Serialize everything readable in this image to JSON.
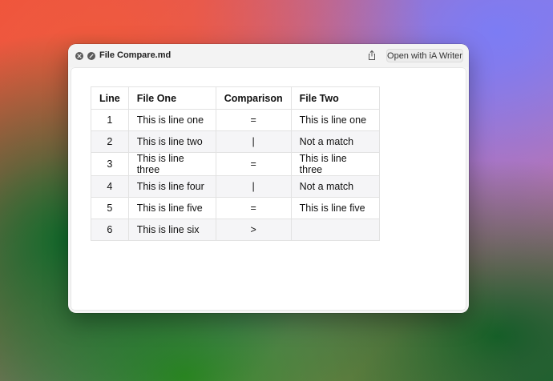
{
  "window": {
    "title": "File Compare.md",
    "open_button_label": "Open with iA Writer"
  },
  "table": {
    "headers": [
      "Line",
      "File One",
      "Comparison",
      "File Two"
    ],
    "rows": [
      [
        "1",
        "This is line one",
        "=",
        "This is line one"
      ],
      [
        "2",
        "This is line two",
        "|",
        "Not a match"
      ],
      [
        "3",
        "This is line three",
        "=",
        "This is line three"
      ],
      [
        "4",
        "This is line four",
        "|",
        "Not a match"
      ],
      [
        "5",
        "This is line five",
        "=",
        "This is line five"
      ],
      [
        "6",
        "This is line six",
        ">",
        ""
      ]
    ]
  },
  "icons": {
    "close": "close-icon",
    "minimize": "minimize-icon",
    "share": "share-icon"
  },
  "colors": {
    "window_bg": "#f5f5f5",
    "content_bg": "#ffffff",
    "row_alt_bg": "#f5f5f7",
    "border": "#e2e2e2"
  }
}
